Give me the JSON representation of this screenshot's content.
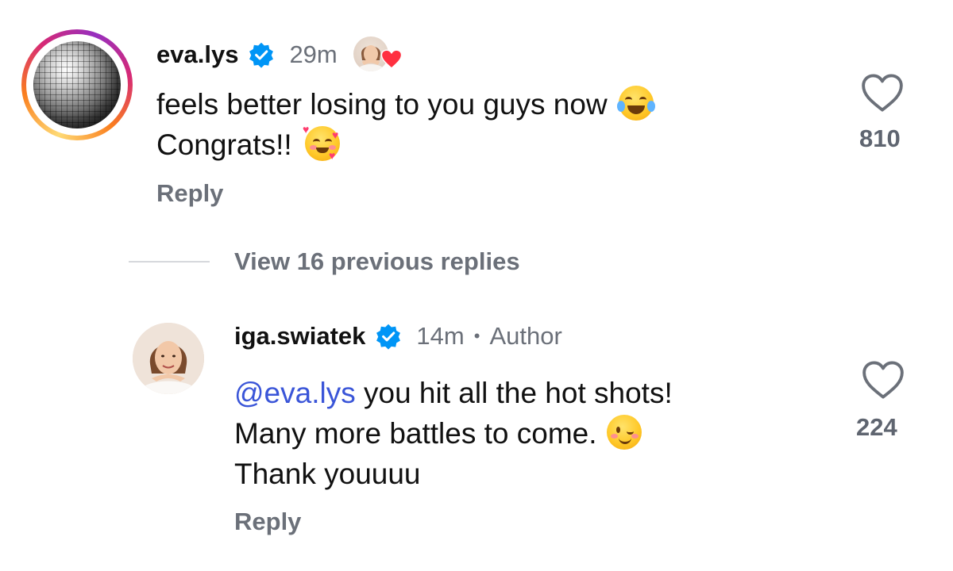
{
  "comments": [
    {
      "username": "eva.lys",
      "time": "29m",
      "text_line1": "feels better losing to you guys now",
      "text_line2": "Congrats!!",
      "reply_label": "Reply",
      "like_count": "810",
      "emoji_line1": "tears-of-joy",
      "emoji_line2": "smiling-face-with-hearts"
    },
    {
      "username": "iga.swiatek",
      "time": "14m",
      "separator": "•",
      "author_badge": "Author",
      "mention": "@eva.lys",
      "text_line1": " you hit all the hot shots!",
      "text_line2": "Many more battles to come.",
      "text_line3": "Thank youuuu",
      "reply_label": "Reply",
      "like_count": "224",
      "emoji_line2": "winking-face"
    }
  ],
  "view_replies_label": "View 16 previous replies",
  "colors": {
    "meta_gray": "#6b7079",
    "mention_blue": "#3a55d8",
    "verified_blue": "#0095f6",
    "liked_heart_red": "#ff3040"
  }
}
